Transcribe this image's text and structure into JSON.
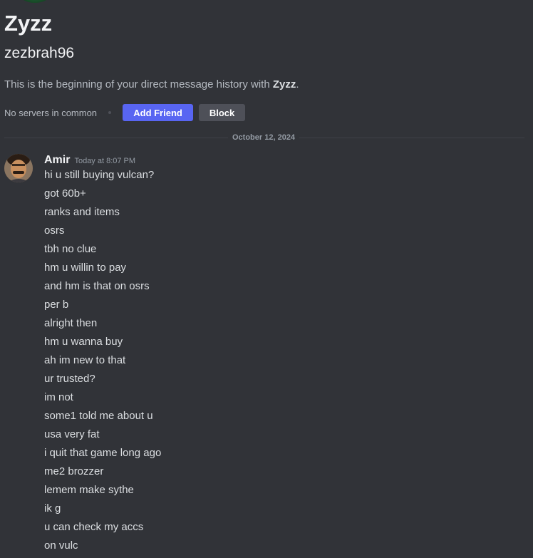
{
  "profile": {
    "display_name": "Zyzz",
    "username": "zezbrah96",
    "intro_prefix": "This is the beginning of your direct message history with ",
    "intro_name": "Zyzz",
    "intro_suffix": "."
  },
  "actions": {
    "servers_text": "No servers in common",
    "add_friend_label": "Add Friend",
    "block_label": "Block"
  },
  "divider": {
    "date": "October 12, 2024"
  },
  "message_group": {
    "author": "Amir",
    "timestamp": "Today at 8:07 PM",
    "messages": [
      "hi u still buying vulcan?",
      "got 60b+",
      "ranks and items",
      "osrs",
      "tbh no clue",
      "hm u willin to pay",
      "and hm is that on osrs",
      "per b",
      "alright then",
      "hm u wanna buy",
      "ah im new to that",
      "ur trusted?",
      "im not",
      "some1 told me about u",
      "usa very fat",
      "i quit that game long ago",
      "me2 brozzer",
      "lemem make sythe",
      "ik g",
      "u can check my accs",
      "on vulc"
    ]
  },
  "colors": {
    "background": "#313338",
    "primary_button": "#5865f2",
    "secondary_button": "#4e5058",
    "text_normal": "#dbdee1",
    "text_muted": "#949ba4",
    "header_text": "#f2f3f5"
  }
}
